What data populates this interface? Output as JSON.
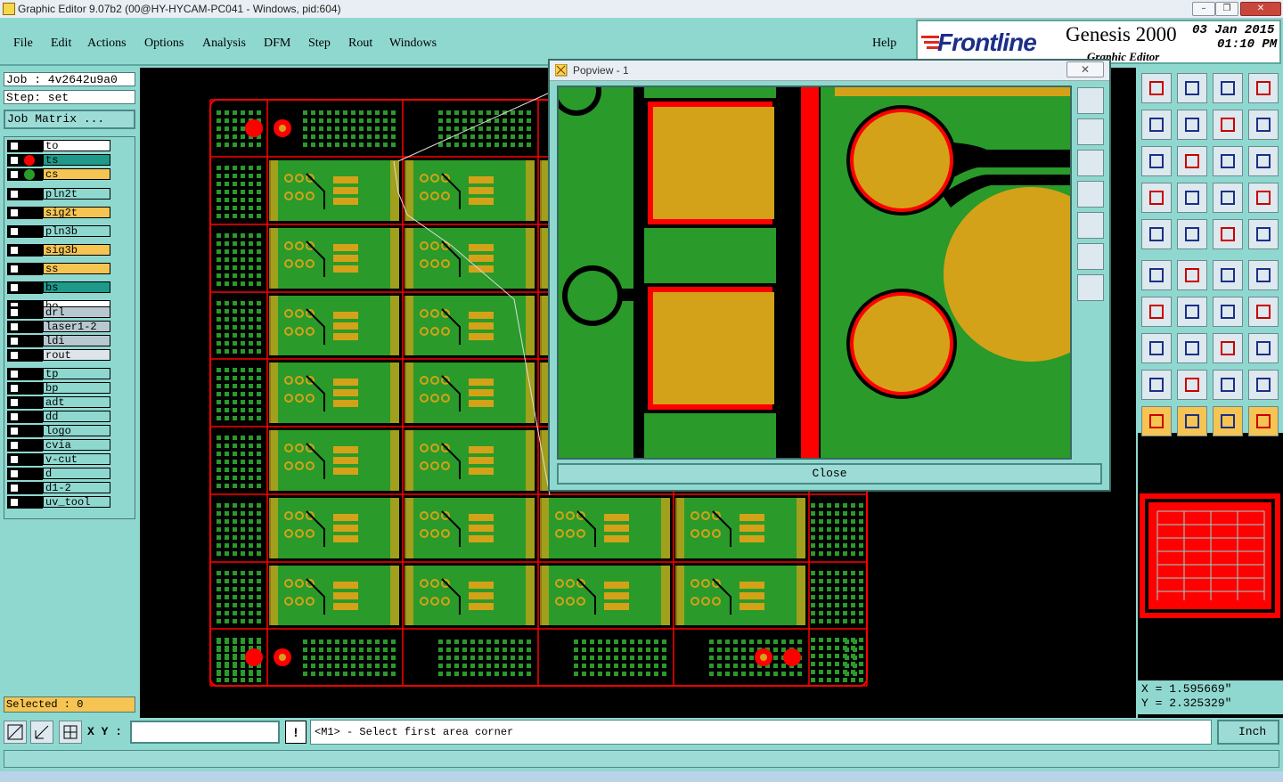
{
  "window": {
    "title": "Graphic Editor 9.07b2 (00@HY-HYCAM-PC041 - Windows, pid:604)",
    "controls": [
      "–",
      "❐",
      "✕"
    ]
  },
  "menu": {
    "items": [
      "File",
      "Edit",
      "Actions",
      "Options",
      "Analysis",
      "DFM",
      "Step",
      "Rout",
      "Windows"
    ],
    "help": "Help"
  },
  "logo": {
    "brand": "Frontline",
    "product": "Genesis 2000",
    "subtitle": "Graphic Editor",
    "date": "03 Jan 2015",
    "time": "01:10 PM"
  },
  "job": {
    "job_label": "Job : 4v2642u9a0",
    "step_label": "Step: set",
    "matrix_button": "Job Matrix ..."
  },
  "layers": {
    "group1": [
      {
        "name": "to",
        "color": "#ffffff"
      },
      {
        "name": "ts",
        "color": "#1f9a8a",
        "dot": "#ff0000"
      },
      {
        "name": "cs",
        "color": "#f5c452",
        "dot": "#2a9a2a"
      }
    ],
    "group2": [
      {
        "name": "pln2t",
        "color": "#8fd8d0"
      },
      {
        "name": "sig2t",
        "color": "#f5c452"
      },
      {
        "name": "pln3b",
        "color": "#8fd8d0"
      },
      {
        "name": "sig3b",
        "color": "#f5c452"
      },
      {
        "name": "ss",
        "color": "#f5c452"
      },
      {
        "name": "bs",
        "color": "#1f9a8a"
      },
      {
        "name": "bo",
        "color": "#ffffff"
      }
    ],
    "group3": [
      {
        "name": "drl",
        "color": "#b8c8d0"
      },
      {
        "name": "laser1-2",
        "color": "#b8c8d0"
      },
      {
        "name": "ldi",
        "color": "#b8c8d0"
      },
      {
        "name": "rout",
        "color": "#dde4ea"
      }
    ],
    "group4": [
      {
        "name": "tp",
        "color": "#8fd8d0"
      },
      {
        "name": "bp",
        "color": "#8fd8d0"
      },
      {
        "name": "adt",
        "color": "#8fd8d0"
      },
      {
        "name": "dd",
        "color": "#8fd8d0"
      },
      {
        "name": "logo",
        "color": "#8fd8d0"
      },
      {
        "name": "cvia",
        "color": "#8fd8d0"
      },
      {
        "name": "v-cut",
        "color": "#8fd8d0"
      },
      {
        "name": "d",
        "color": "#8fd8d0"
      },
      {
        "name": "d1-2",
        "color": "#8fd8d0"
      },
      {
        "name": "uv_tool",
        "color": "#8fd8d0"
      }
    ]
  },
  "selected_label": "Selected : 0",
  "popview": {
    "title": "Popview - 1",
    "close_label": "Close"
  },
  "coords": {
    "x": "X = 1.595669\"",
    "y": "Y = 2.325329\""
  },
  "statusbar": {
    "xy_label": "X Y :",
    "xy_value": "",
    "alert": "!",
    "prompt": "<M1> - Select first area corner",
    "units": "Inch"
  },
  "colors": {
    "board_green": "#2a9a2a",
    "pad_gold": "#d4a218",
    "outline_red": "#ff0000",
    "panel_teal": "#8fd8d0"
  }
}
